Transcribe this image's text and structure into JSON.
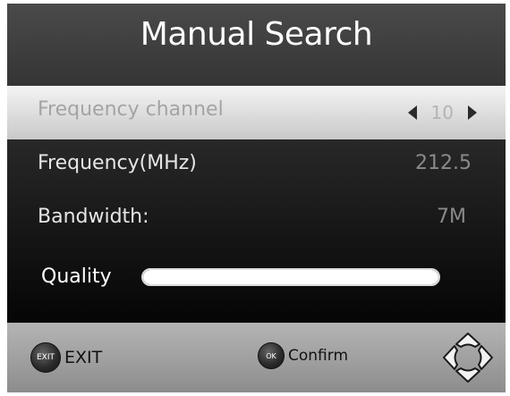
{
  "title": "Manual Search",
  "rows": [
    {
      "label": "Frequency channel",
      "value": "10",
      "selected": true
    },
    {
      "label": "Frequency(MHz)",
      "value": "212.5"
    },
    {
      "label": "Bandwidth:",
      "value": "7M"
    }
  ],
  "quality": {
    "label": "Quality",
    "level": 1.0
  },
  "footer": {
    "exit_key": "EXIT",
    "exit_label": "EXIT",
    "ok_key": "OK",
    "confirm_label": "Confirm"
  },
  "colors": {
    "selected_row": "#dedede",
    "footer": "#a8a8a8",
    "text": "#ffffff"
  },
  "icons": [
    "arrow-left-icon",
    "arrow-right-icon",
    "exit-key-icon",
    "ok-key-icon",
    "navigation-pad-icon"
  ]
}
